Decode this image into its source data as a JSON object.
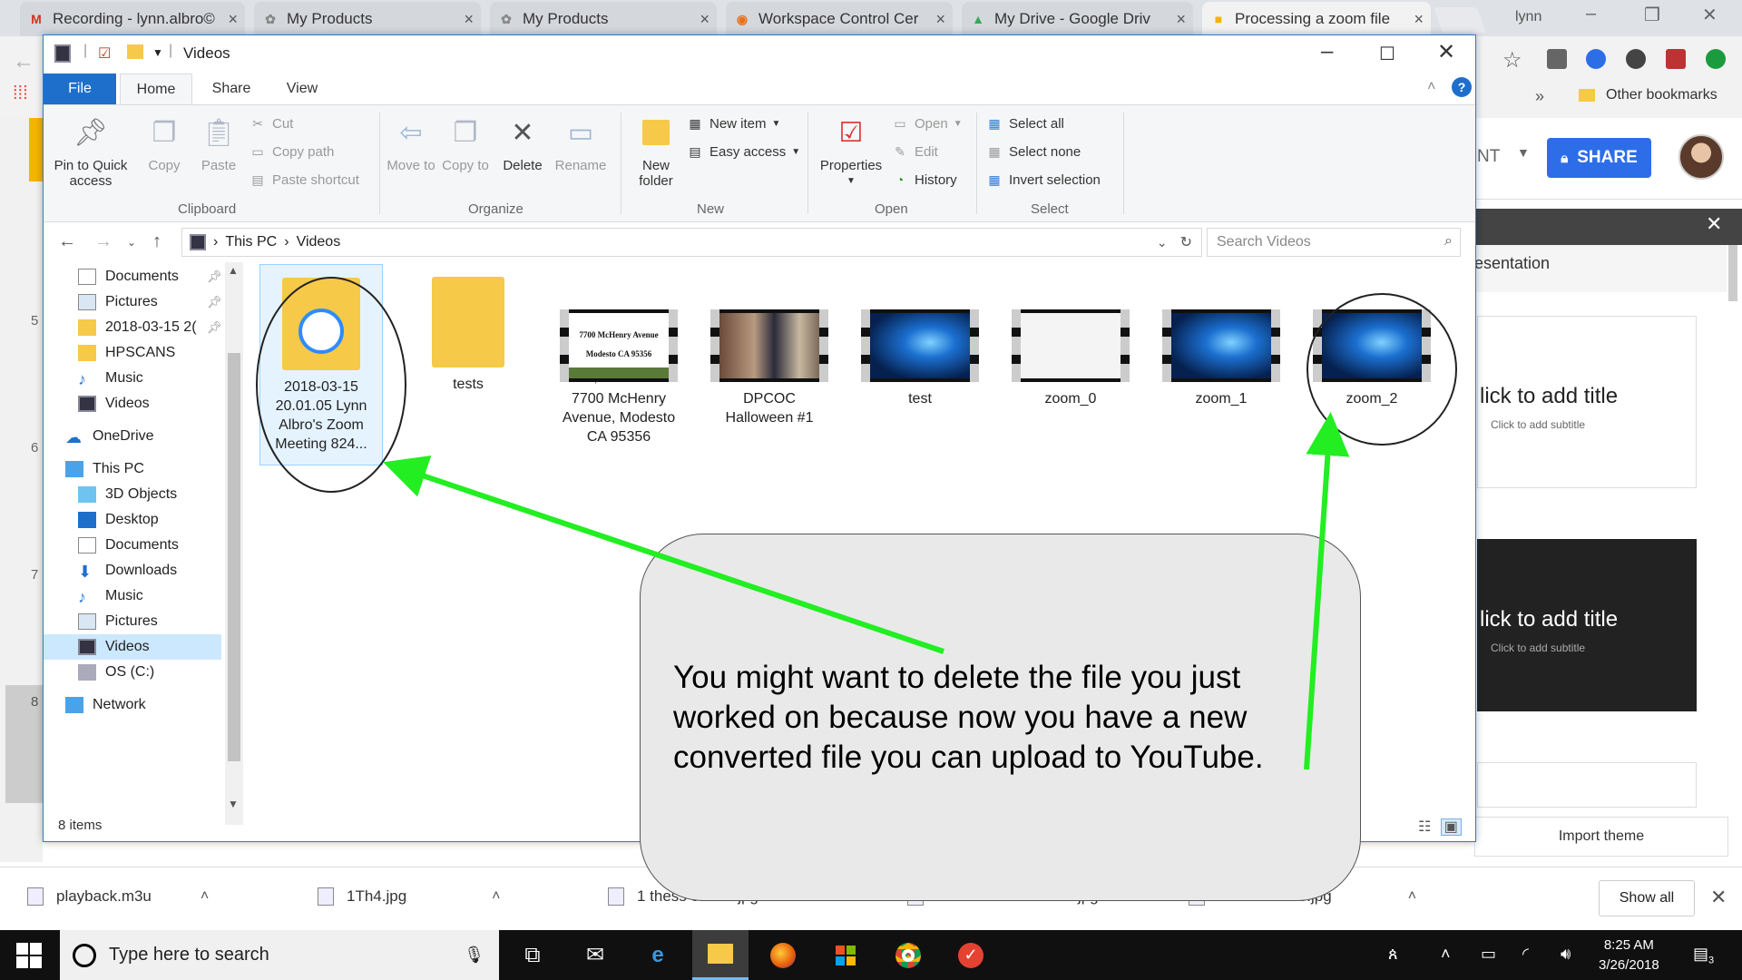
{
  "browser": {
    "tabs": [
      {
        "title": "Recording - lynn.albro©",
        "icon": "gmail-icon",
        "color": "#d93025"
      },
      {
        "title": "My Products",
        "icon": "puzzle-icon",
        "color": "#888888"
      },
      {
        "title": "My Products",
        "icon": "puzzle-icon",
        "color": "#888888"
      },
      {
        "title": "Workspace Control Cer",
        "icon": "orange-app-icon",
        "color": "#e8711a"
      },
      {
        "title": "My Drive - Google Driv",
        "icon": "drive-icon",
        "color": "#34a853"
      },
      {
        "title": "Processing a zoom file",
        "icon": "slides-icon",
        "color": "#f4b400"
      }
    ],
    "user_name": "lynn",
    "bookmarks_other": "Other bookmarks"
  },
  "slides_app": {
    "share_label": "SHARE",
    "nt_text": "NT",
    "panel_title": "esentation",
    "thumb_title": "lick to add title",
    "thumb_subtitle": "Click to add subtitle",
    "import_theme": "Import theme",
    "side_numbers": [
      "5",
      "6",
      "7",
      "8"
    ]
  },
  "explorer": {
    "title": "Videos",
    "ribbon_tabs": [
      "File",
      "Home",
      "Share",
      "View"
    ],
    "clipboard": {
      "group": "Clipboard",
      "pin": "Pin to Quick access",
      "copy": "Copy",
      "paste": "Paste",
      "cut": "Cut",
      "copy_path": "Copy path",
      "paste_shortcut": "Paste shortcut"
    },
    "organize": {
      "group": "Organize",
      "move_to": "Move to",
      "copy_to": "Copy to",
      "delete": "Delete",
      "rename": "Rename"
    },
    "new": {
      "group": "New",
      "new_folder": "New folder",
      "new_item": "New item",
      "easy_access": "Easy access"
    },
    "open": {
      "group": "Open",
      "properties": "Properties",
      "open": "Open",
      "edit": "Edit",
      "history": "History"
    },
    "select": {
      "group": "Select",
      "select_all": "Select all",
      "select_none": "Select none",
      "invert_selection": "Invert selection"
    },
    "address": {
      "crumbs": [
        "This PC",
        "Videos"
      ],
      "search_placeholder": "Search Videos"
    },
    "nav": [
      {
        "label": "Documents",
        "pinned": true,
        "icon": "documents-icon"
      },
      {
        "label": "Pictures",
        "pinned": true,
        "icon": "pictures-icon"
      },
      {
        "label": "2018-03-15 2(",
        "pinned": true,
        "icon": "folder-icon"
      },
      {
        "label": "HPSCANS",
        "pinned": false,
        "icon": "folder-icon"
      },
      {
        "label": "Music",
        "pinned": false,
        "icon": "music-icon"
      },
      {
        "label": "Videos",
        "pinned": false,
        "icon": "videos-icon"
      },
      {
        "label": "OneDrive",
        "pinned": false,
        "icon": "onedrive-icon"
      },
      {
        "label": "This PC",
        "pinned": false,
        "icon": "pc-icon"
      },
      {
        "label": "3D Objects",
        "pinned": false,
        "icon": "3d-objects-icon"
      },
      {
        "label": "Desktop",
        "pinned": false,
        "icon": "desktop-icon"
      },
      {
        "label": "Documents",
        "pinned": false,
        "icon": "documents-icon"
      },
      {
        "label": "Downloads",
        "pinned": false,
        "icon": "downloads-icon"
      },
      {
        "label": "Music",
        "pinned": false,
        "icon": "music-icon"
      },
      {
        "label": "Pictures",
        "pinned": false,
        "icon": "pictures-icon"
      },
      {
        "label": "Videos",
        "pinned": false,
        "icon": "videos-icon",
        "selected": true
      },
      {
        "label": "OS (C:)",
        "pinned": false,
        "icon": "drive-icon"
      },
      {
        "label": "Network",
        "pinned": false,
        "icon": "network-icon"
      }
    ],
    "files": [
      {
        "name": "2018-03-15 20.01.05 Lynn Albro's Zoom Meeting 824...",
        "kind": "folder-zoom"
      },
      {
        "name": "tests",
        "kind": "folder"
      },
      {
        "name": "7700 McHenry Avenue, Modesto CA 95356",
        "kind": "video-doc",
        "thumb_line1": "7700 McHenry Avenue",
        "thumb_line2": "Modesto CA 95356",
        "thumb_line3": "1050 Sq.Ft. Home on 13.83 Acres"
      },
      {
        "name": "DPCOC Halloween #1",
        "kind": "video-photo"
      },
      {
        "name": "test",
        "kind": "video-win"
      },
      {
        "name": "zoom_0",
        "kind": "video-white"
      },
      {
        "name": "zoom_1",
        "kind": "video-win"
      },
      {
        "name": "zoom_2",
        "kind": "video-win"
      }
    ],
    "status": "8 items"
  },
  "downloads": {
    "items": [
      "playback.m3u",
      "1Th4.jpg",
      "1 thess 5.8-11.jpg",
      "1 thessalonians 5 ....jpg",
      "1 thess 5.5-8.jpg"
    ],
    "show_all": "Show all"
  },
  "taskbar": {
    "search_placeholder": "Type here to search",
    "time": "8:25 AM",
    "date": "3/26/2018",
    "notification_count": "3"
  },
  "annotation": {
    "text": "You might want to delete the file you just worked on because now you have a new converted file you can upload to YouTube.",
    "arrow_color": "#22ee22"
  }
}
